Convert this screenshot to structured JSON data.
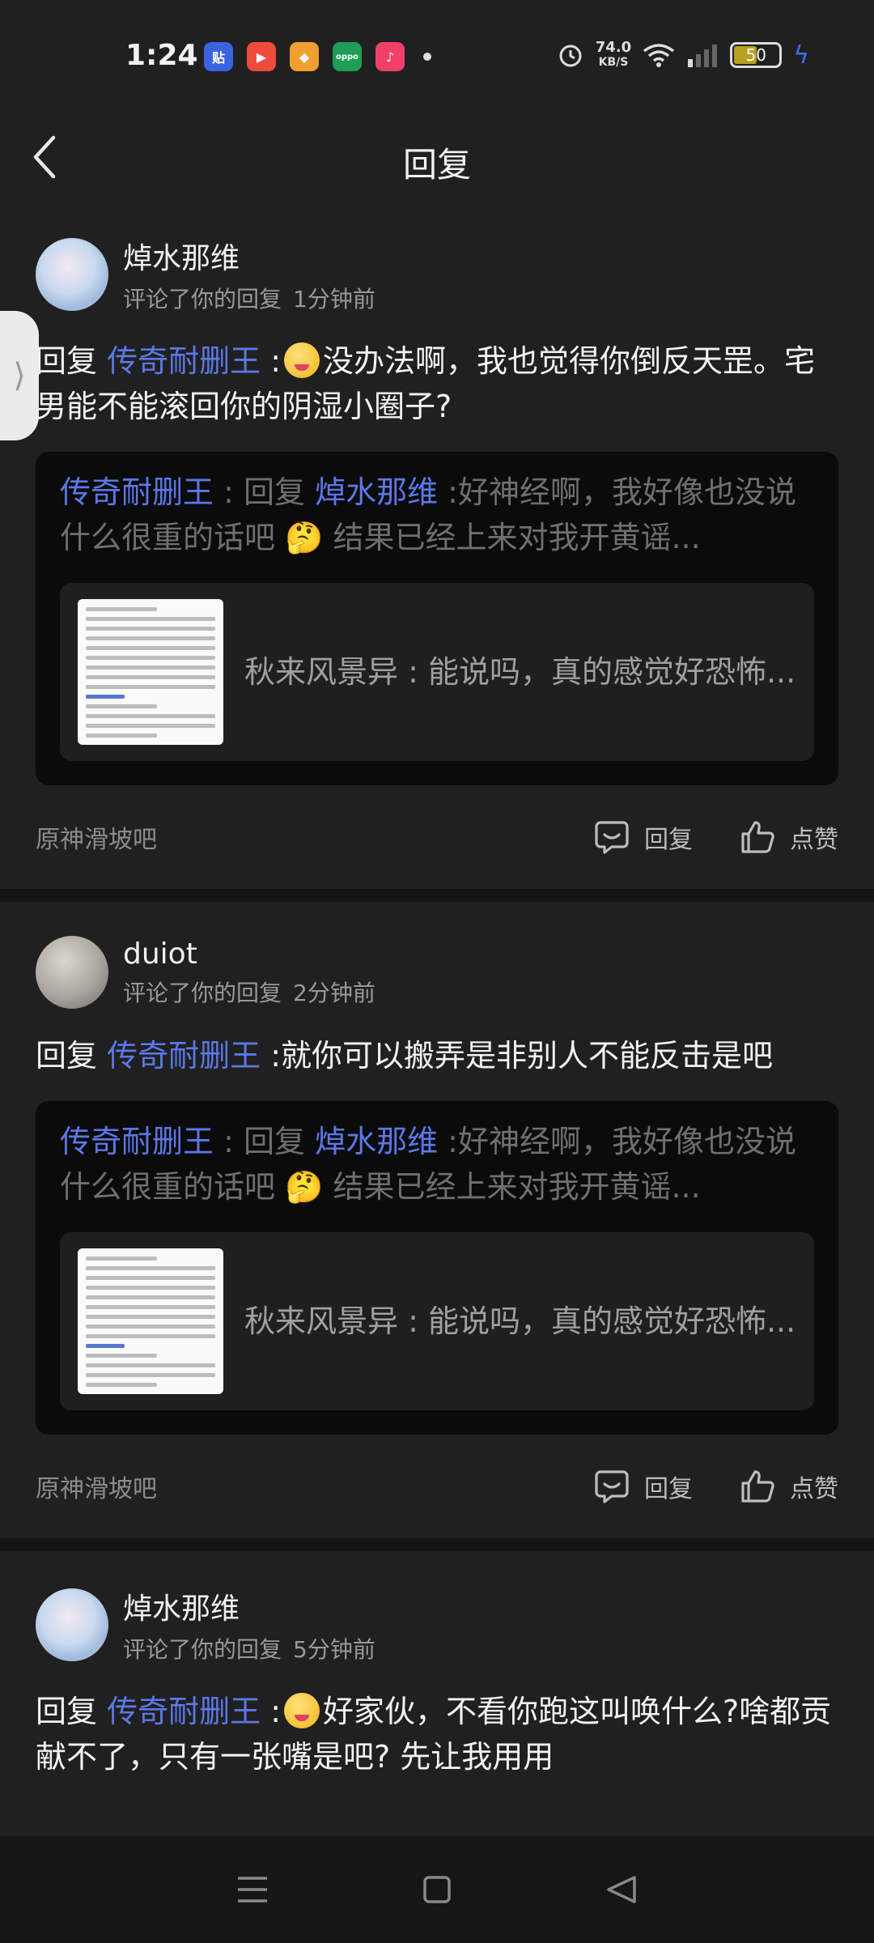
{
  "status_bar": {
    "time": "1:24",
    "net_speed": "74.0",
    "net_unit": "KB/S",
    "battery": "50",
    "apps": [
      {
        "name": "tieba-icon",
        "glyph": "贴",
        "color": "#3a63e0"
      },
      {
        "name": "video-icon",
        "glyph": "▶",
        "color": "#ef4b3c"
      },
      {
        "name": "gallery-icon",
        "glyph": "◆",
        "color": "#f0a030"
      },
      {
        "name": "oppo-store-icon",
        "glyph": "oppo",
        "color": "#1f9d55"
      },
      {
        "name": "music-icon",
        "glyph": "♪",
        "color": "#f0406a"
      }
    ]
  },
  "header": {
    "title": "回复"
  },
  "side_handle_glyph": "⟩",
  "notifications": [
    {
      "avatar": "anime",
      "username": "焯水那维",
      "action": "评论了你的回复",
      "time": "1分钟前",
      "reply_prefix": "回复 ",
      "reply_mention": "传奇耐删王",
      "reply_sep": " :",
      "reply_body": "没办法啊，我也觉得你倒反天罡。宅男能不能滚回你的阴湿小圈子?",
      "has_emoji": true,
      "quote_author": "传奇耐删王",
      "quote_mid": " : 回复 ",
      "quote_mention": "焯水那维",
      "quote_body": " :好神经啊，我好像也没说什么很重的话吧 🤔 结果已经上来对我开黄谣...",
      "inner_text": "秋来风景异 : 能说吗，真的感觉好恐怖...",
      "forum": "原神滑坡吧",
      "reply_label": "回复",
      "like_label": "点赞"
    },
    {
      "avatar": "gray",
      "username": "duiot",
      "action": "评论了你的回复",
      "time": "2分钟前",
      "reply_prefix": "回复 ",
      "reply_mention": "传奇耐删王",
      "reply_sep": " :",
      "reply_body": "就你可以搬弄是非别人不能反击是吧",
      "has_emoji": false,
      "quote_author": "传奇耐删王",
      "quote_mid": " : 回复 ",
      "quote_mention": "焯水那维",
      "quote_body": " :好神经啊，我好像也没说什么很重的话吧 🤔 结果已经上来对我开黄谣...",
      "inner_text": "秋来风景异 : 能说吗，真的感觉好恐怖...",
      "forum": "原神滑坡吧",
      "reply_label": "回复",
      "like_label": "点赞"
    },
    {
      "avatar": "anime",
      "username": "焯水那维",
      "action": "评论了你的回复",
      "time": "5分钟前",
      "reply_prefix": "回复 ",
      "reply_mention": "传奇耐删王",
      "reply_sep": " :",
      "reply_body": "好家伙，不看你跑这叫唤什么?啥都贡献不了，只有一张嘴是吧? 先让我用用",
      "has_emoji": true
    }
  ]
}
